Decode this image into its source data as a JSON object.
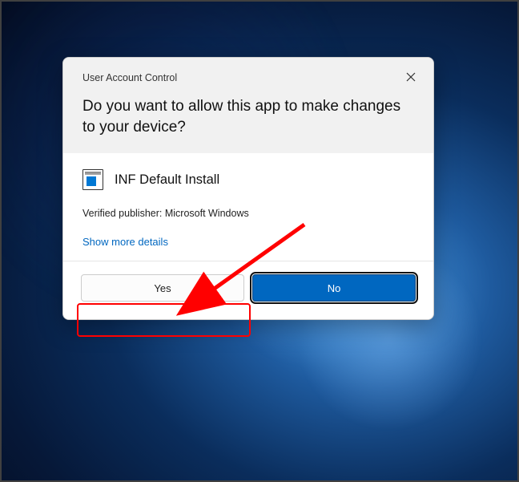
{
  "dialog": {
    "title": "User Account Control",
    "question": "Do you want to allow this app to make changes to your device?",
    "app_name": "INF Default Install",
    "publisher": "Verified publisher: Microsoft Windows",
    "details_link": "Show more details",
    "yes_label": "Yes",
    "no_label": "No"
  }
}
